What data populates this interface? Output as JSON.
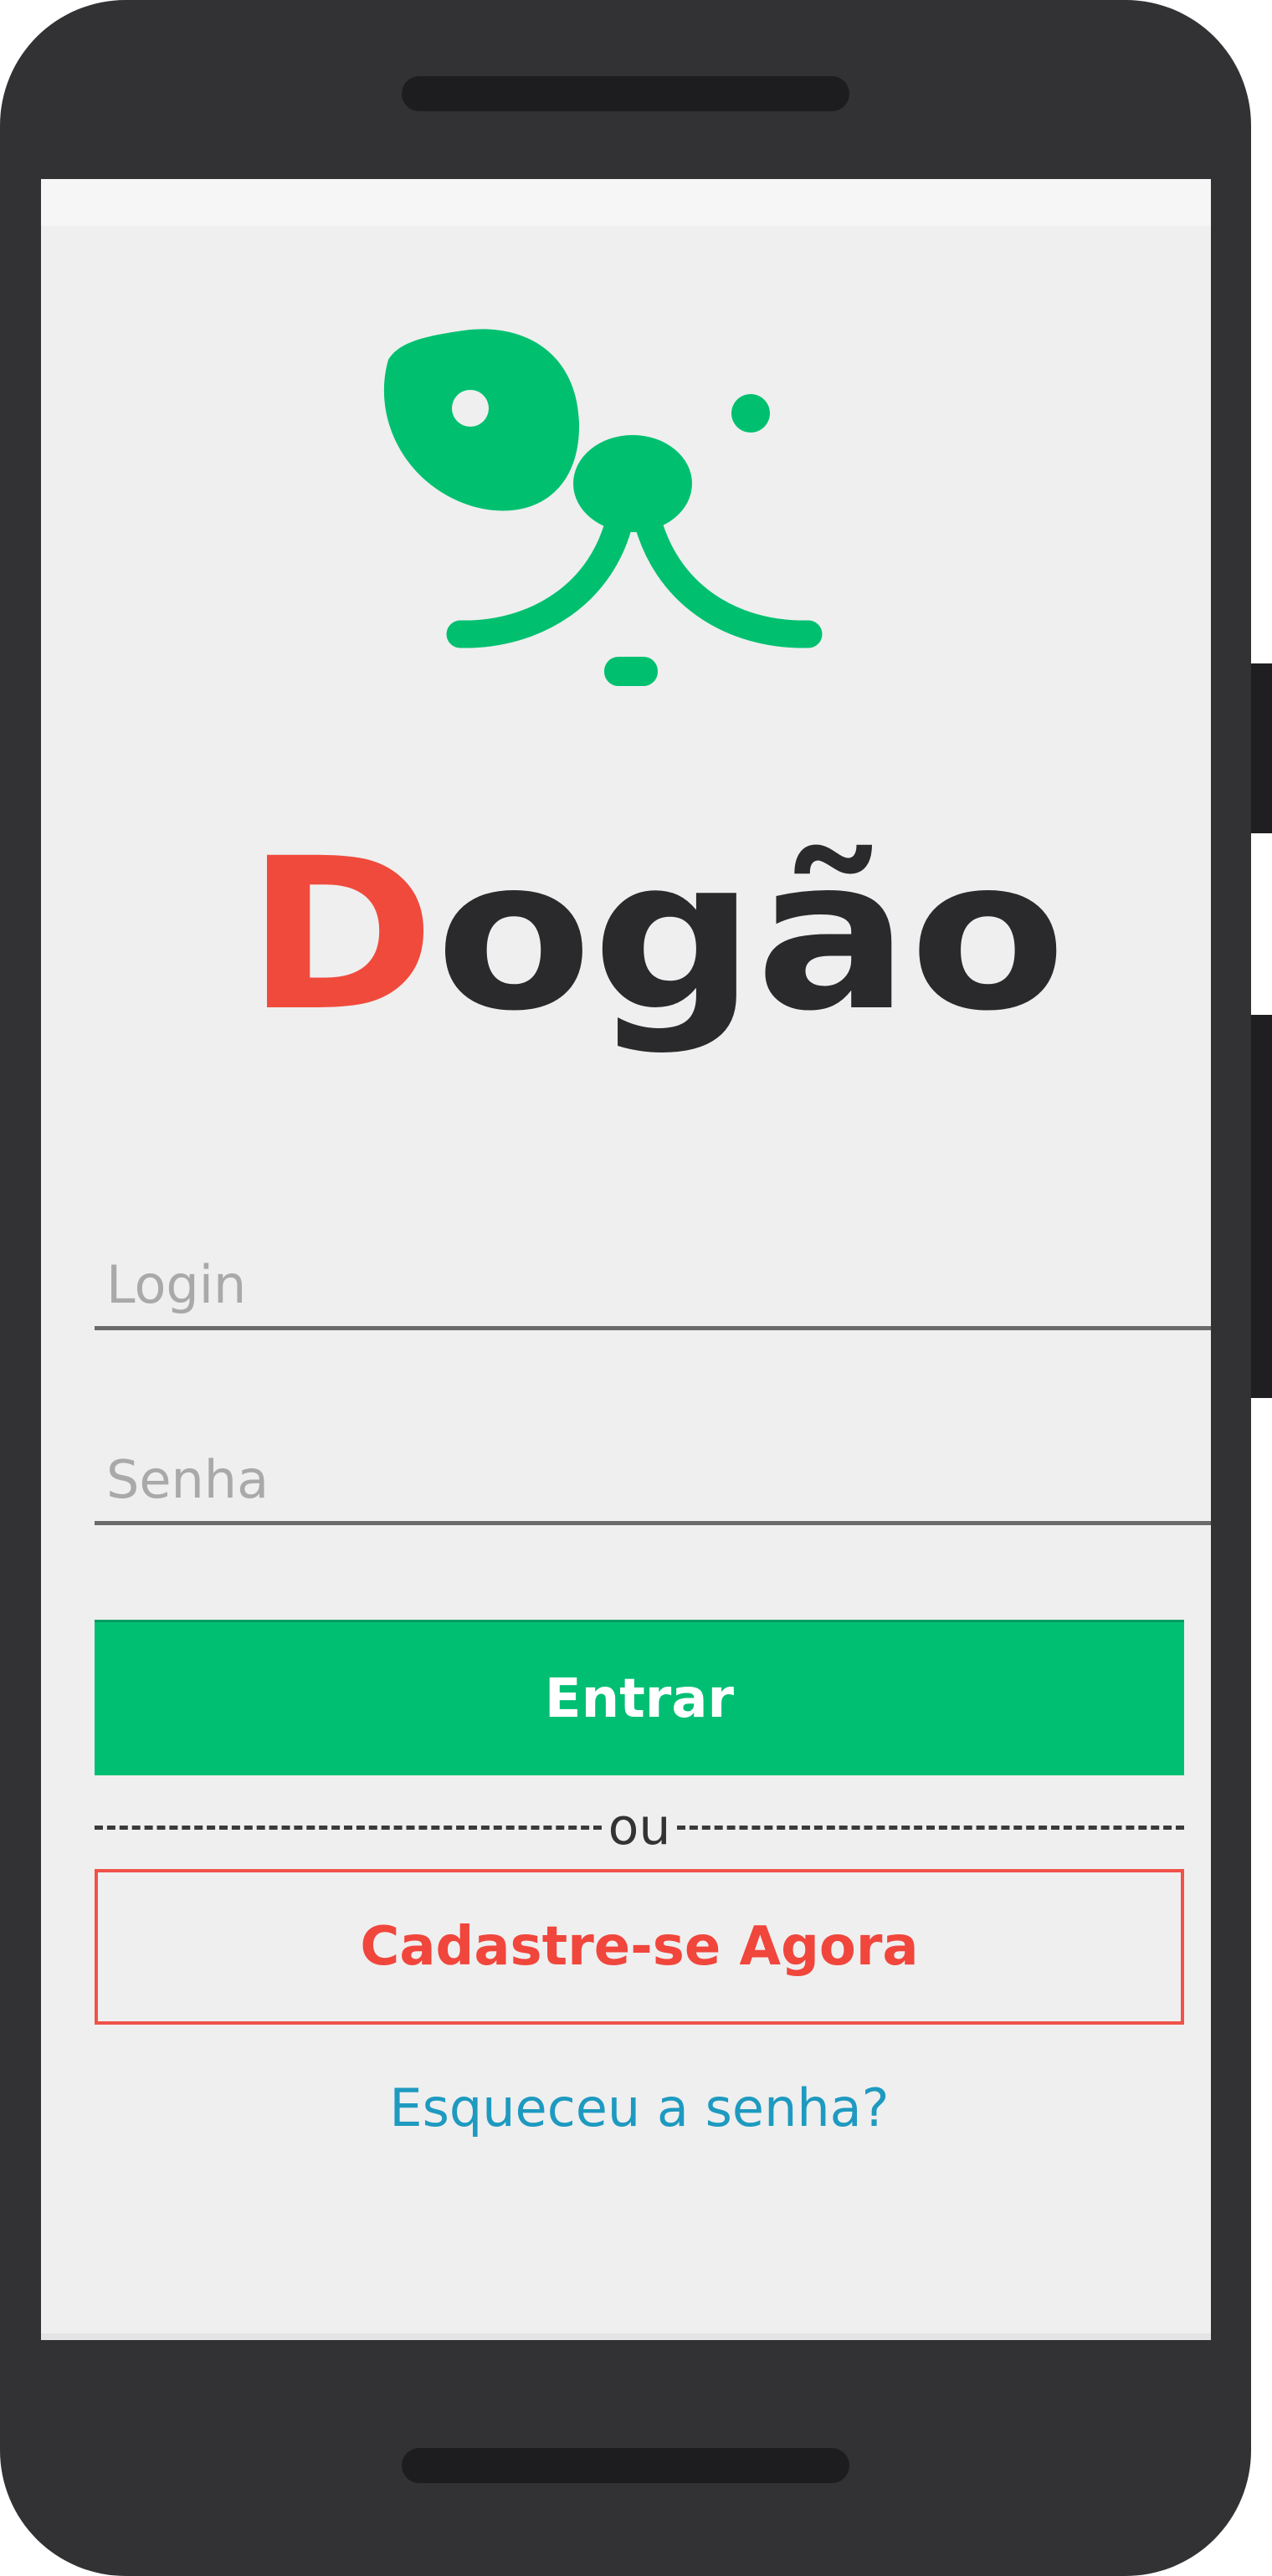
{
  "app": {
    "brand_first_letter": "D",
    "brand_rest": "ogão",
    "brand_colors": {
      "accent": "#f04a3c",
      "dark": "#2a2a2c",
      "green": "#00bf73"
    }
  },
  "login": {
    "login_placeholder": "Login",
    "password_placeholder": "Senha",
    "submit_label": "Entrar",
    "divider_text": "ou",
    "signup_label": "Cadastre-se Agora",
    "forgot_label": "Esqueceu a senha?"
  },
  "icons": {
    "logo": "dog-face-icon"
  }
}
